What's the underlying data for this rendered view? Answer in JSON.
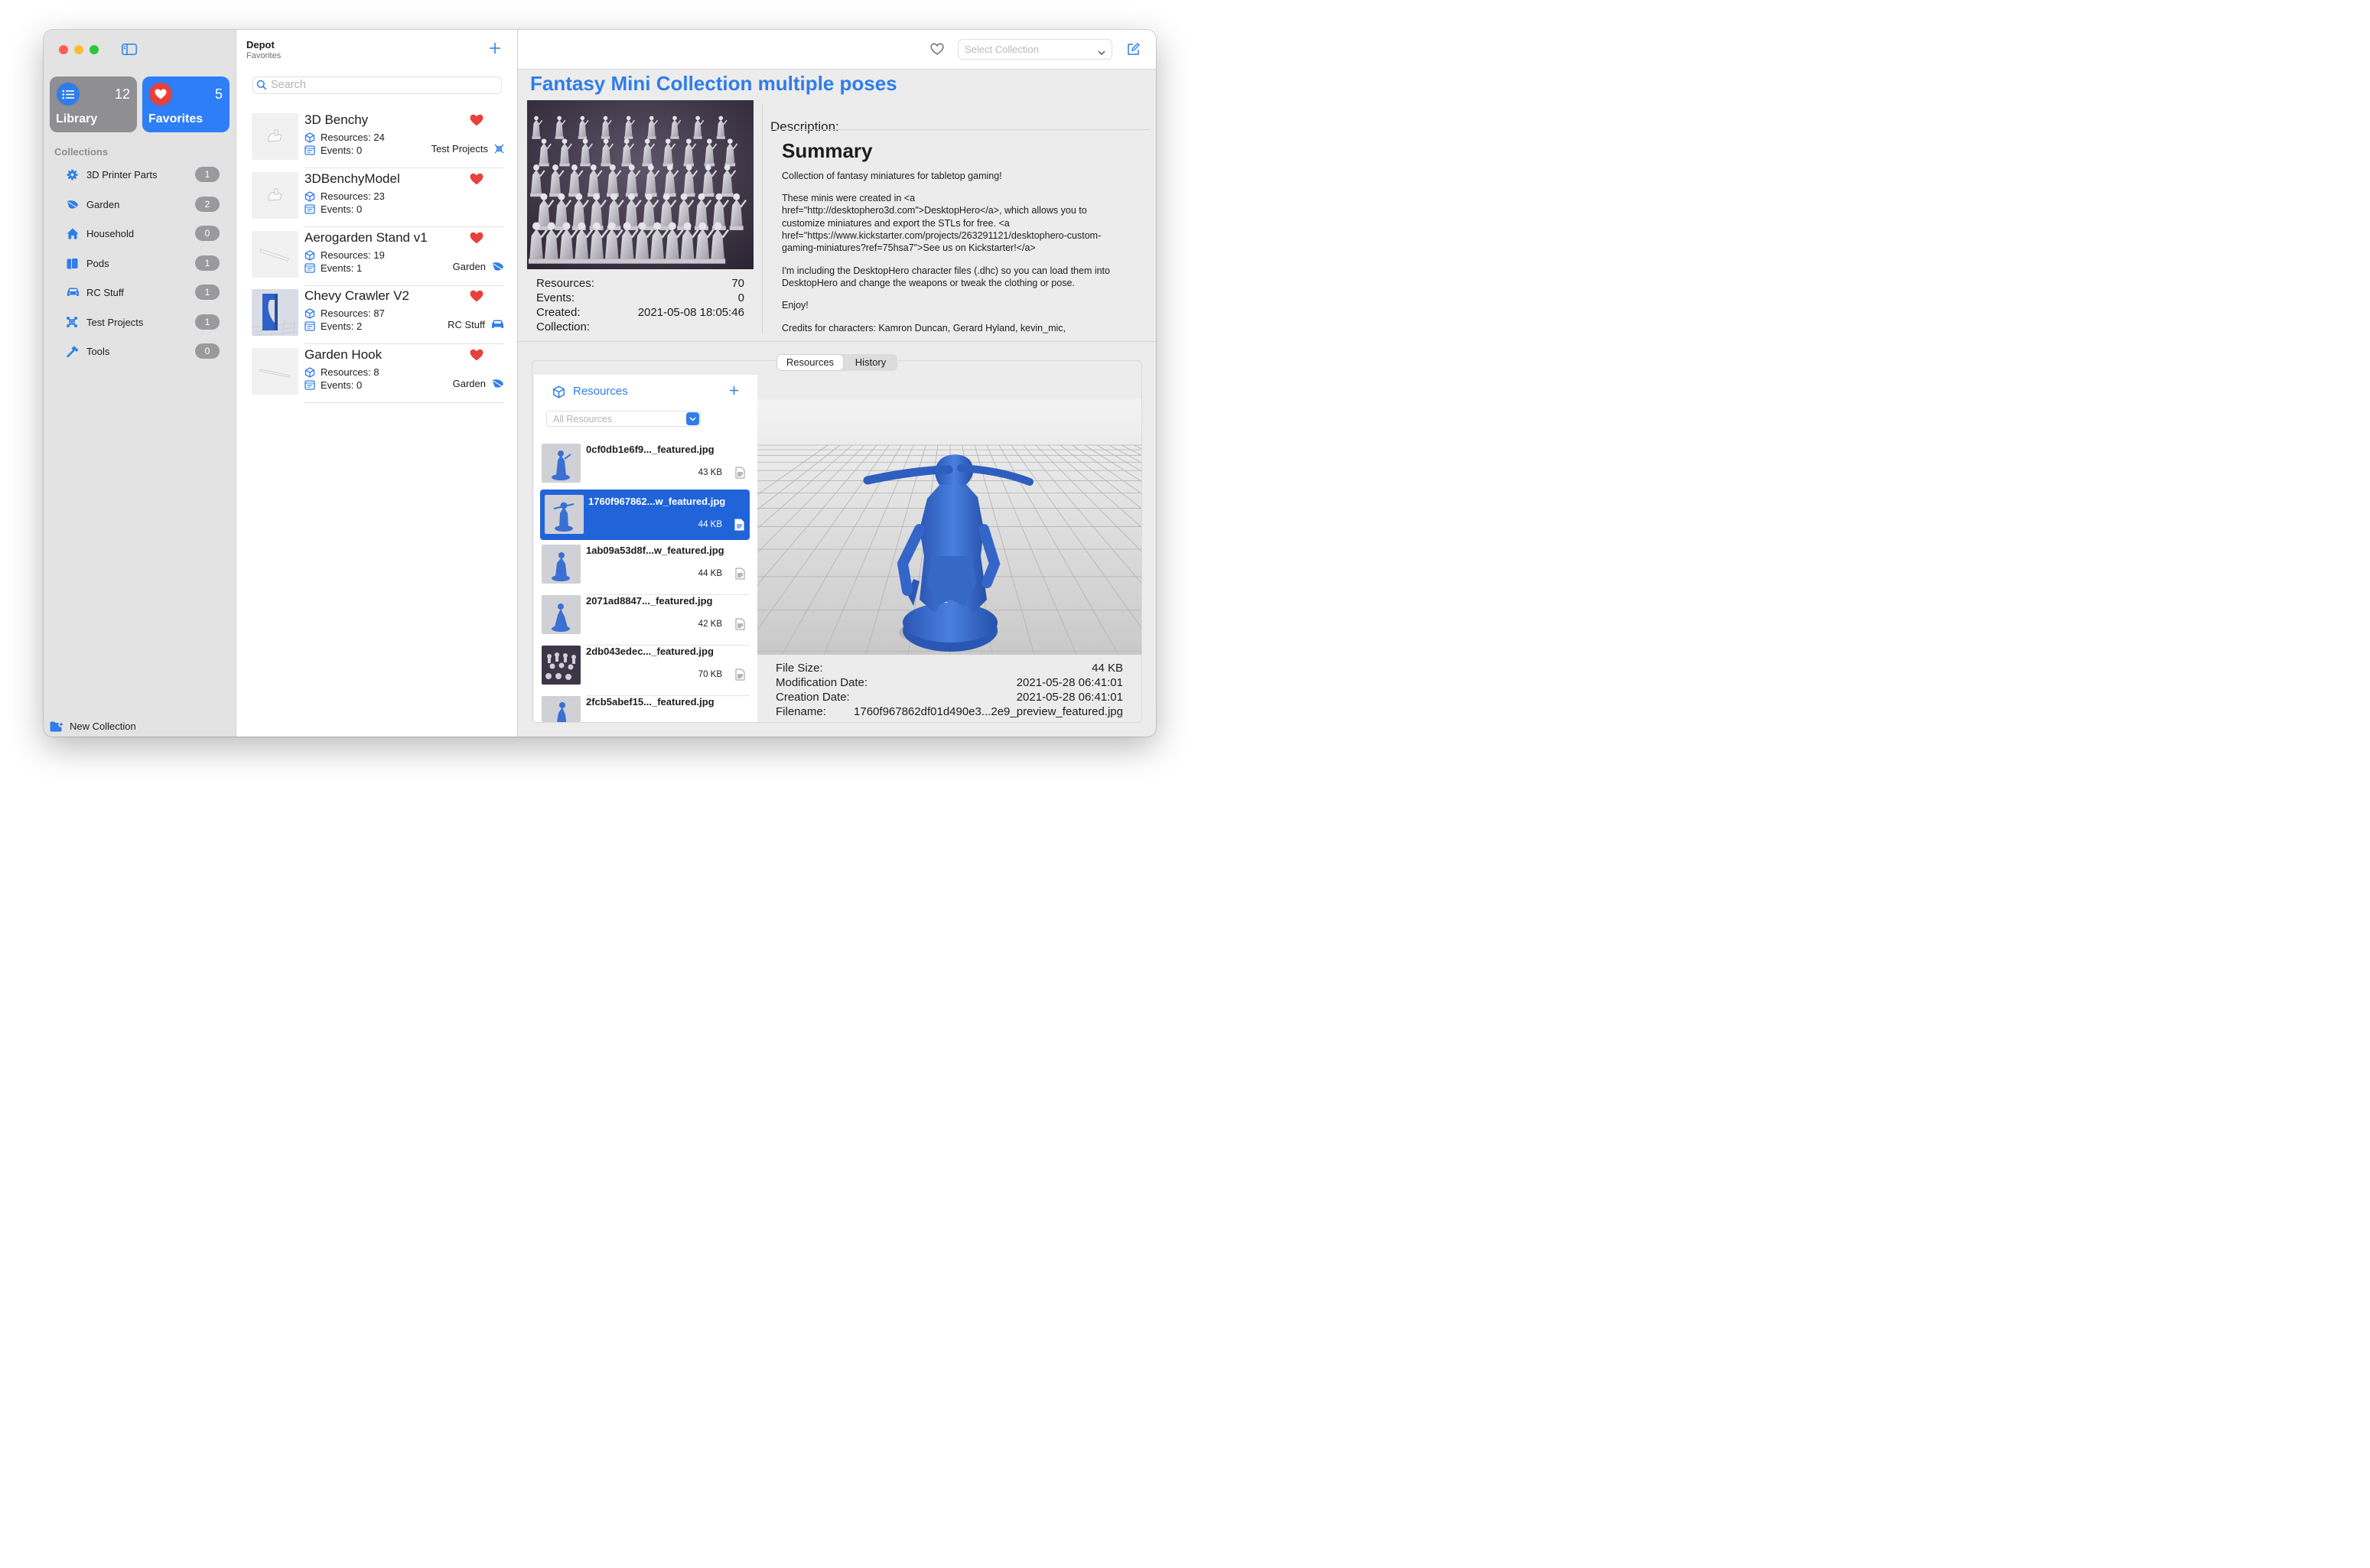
{
  "sidebar": {
    "library": {
      "label": "Library",
      "count": "12"
    },
    "favorites": {
      "label": "Favorites",
      "count": "5"
    },
    "collections_title": "Collections",
    "collections": [
      {
        "label": "3D Printer Parts",
        "count": "1",
        "icon": "gear-icon"
      },
      {
        "label": "Garden",
        "count": "2",
        "icon": "leaf-icon"
      },
      {
        "label": "Household",
        "count": "0",
        "icon": "house-icon"
      },
      {
        "label": "Pods",
        "count": "1",
        "icon": "cylinders-icon"
      },
      {
        "label": "RC Stuff",
        "count": "1",
        "icon": "car-icon"
      },
      {
        "label": "Test Projects",
        "count": "1",
        "icon": "grid-icon"
      },
      {
        "label": "Tools",
        "count": "0",
        "icon": "hammer-icon"
      }
    ],
    "new_collection": "New Collection"
  },
  "list": {
    "title": "Depot",
    "subtitle": "Favorites",
    "search_placeholder": "Search",
    "items": [
      {
        "title": "3D Benchy",
        "resources": "Resources: 24",
        "events": "Events: 0",
        "tag": "Test Projects",
        "tag_icon": "grid-icon"
      },
      {
        "title": "3DBenchyModel",
        "resources": "Resources: 23",
        "events": "Events: 0",
        "tag": "",
        "tag_icon": ""
      },
      {
        "title": "Aerogarden Stand v1",
        "resources": "Resources: 19",
        "events": "Events: 1",
        "tag": "Garden",
        "tag_icon": "leaf-icon"
      },
      {
        "title": "Chevy Crawler V2",
        "resources": "Resources: 87",
        "events": "Events: 2",
        "tag": "RC Stuff",
        "tag_icon": "car-icon"
      },
      {
        "title": "Garden Hook",
        "resources": "Resources: 8",
        "events": "Events: 0",
        "tag": "Garden",
        "tag_icon": "leaf-icon"
      }
    ]
  },
  "detail": {
    "collection_placeholder": "Select Collection",
    "title": "Fantasy Mini Collection multiple poses",
    "info": [
      {
        "label": "Resources:",
        "value": "70"
      },
      {
        "label": "Events:",
        "value": "0"
      },
      {
        "label": "Created:",
        "value": "2021-05-08 18:05:46"
      },
      {
        "label": "Collection:",
        "value": ""
      }
    ],
    "description_label": "Description:",
    "summary_heading": "Summary",
    "paragraphs": [
      "Collection of fantasy miniatures for tabletop gaming!",
      "These minis were created in <a href=\"http://desktophero3d.com\">DesktopHero</a>, which allows you to customize miniatures and export the STLs for free. <a href=\"https://www.kickstarter.com/projects/263291121/desktophero-custom-gaming-miniatures?ref=75hsa7\">See us on Kickstarter!</a>",
      "I'm including the DesktopHero character files (.dhc) so you can load them into DesktopHero and change the weapons or tweak the clothing or pose.",
      "Enjoy!",
      "Credits for characters: Kamron Duncan, Gerard Hyland, kevin_mic,"
    ],
    "tabs": [
      "Resources",
      "History"
    ],
    "resources": {
      "title": "Resources",
      "filter": "All Resources",
      "items": [
        {
          "name": "0cf0db1e6f9..._featured.jpg",
          "size": "43 KB",
          "selected": false
        },
        {
          "name": "1760f967862...w_featured.jpg",
          "size": "44 KB",
          "selected": true
        },
        {
          "name": "1ab09a53d8f...w_featured.jpg",
          "size": "44 KB",
          "selected": false
        },
        {
          "name": "2071ad8847..._featured.jpg",
          "size": "42 KB",
          "selected": false
        },
        {
          "name": "2db043edec..._featured.jpg",
          "size": "70 KB",
          "selected": false
        },
        {
          "name": "2fcb5abef15..._featured.jpg",
          "size": "",
          "selected": false
        }
      ]
    },
    "file": [
      {
        "label": "File Size:",
        "value": "44 KB"
      },
      {
        "label": "Modification Date:",
        "value": "2021-05-28 06:41:01"
      },
      {
        "label": "Creation Date:",
        "value": "2021-05-28 06:41:01"
      },
      {
        "label": "Filename:",
        "value": "1760f967862df01d490e3...2e9_preview_featured.jpg"
      }
    ]
  },
  "colors": {
    "accent": "#2f7dea",
    "favorites_tile": "#2d7ef7",
    "heart": "#e8403a",
    "selected_row": "#2163d9",
    "model_blue": "#3b6fd2"
  }
}
